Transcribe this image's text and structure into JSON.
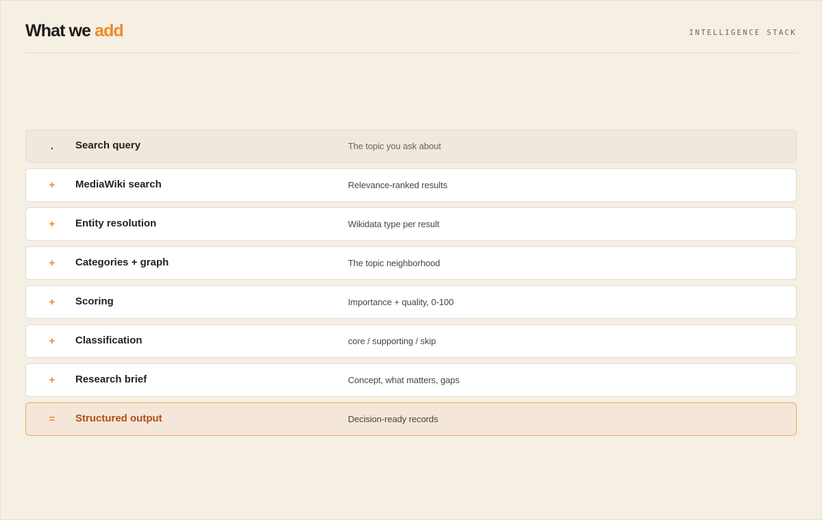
{
  "header": {
    "title_main": "What we ",
    "title_accent": "add",
    "eyebrow": "INTELLIGENCE STACK"
  },
  "stack": [
    {
      "marker": ".",
      "label": "Search query",
      "desc": "The topic you ask about",
      "kind": "base"
    },
    {
      "marker": "+",
      "label": "MediaWiki search",
      "desc": "Relevance-ranked results",
      "kind": "add"
    },
    {
      "marker": "+",
      "label": "Entity resolution",
      "desc": "Wikidata type per result",
      "kind": "add"
    },
    {
      "marker": "+",
      "label": "Categories + graph",
      "desc": "The topic neighborhood",
      "kind": "add"
    },
    {
      "marker": "+",
      "label": "Scoring",
      "desc": "Importance + quality, 0-100",
      "kind": "add"
    },
    {
      "marker": "+",
      "label": "Classification",
      "desc": "core / supporting / skip",
      "kind": "add"
    },
    {
      "marker": "+",
      "label": "Research brief",
      "desc": "Concept, what matters, gaps",
      "kind": "add"
    },
    {
      "marker": "=",
      "label": "Structured output",
      "desc": "Decision-ready records",
      "kind": "result"
    }
  ],
  "colors": {
    "accent": "#f08a24",
    "background": "#f5efe4",
    "result_text": "#b04e14"
  }
}
